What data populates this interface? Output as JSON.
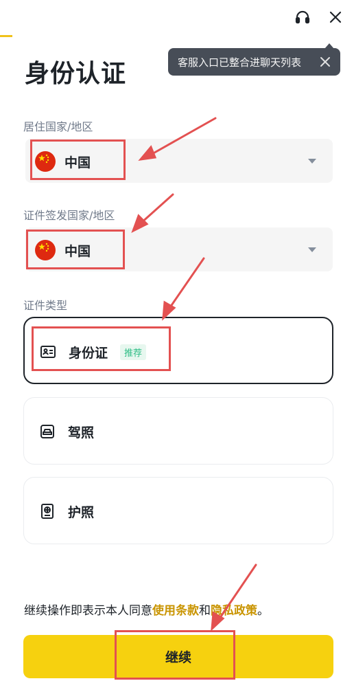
{
  "toast": {
    "text": "客服入口已整合进聊天列表"
  },
  "page": {
    "title": "身份认证"
  },
  "residence": {
    "label": "居住国家/地区",
    "value": "中国"
  },
  "issuing": {
    "label": "证件签发国家/地区",
    "value": "中国"
  },
  "doc_type": {
    "label": "证件类型",
    "options": [
      {
        "label": "身份证",
        "badge": "推荐",
        "icon": "id-card-icon",
        "selected": true
      },
      {
        "label": "驾照",
        "icon": "driver-license-icon",
        "selected": false
      },
      {
        "label": "护照",
        "icon": "passport-icon",
        "selected": false
      }
    ]
  },
  "terms": {
    "prefix": "继续操作即表示本人同意",
    "link1": "使用条款",
    "and": "和",
    "link2": "隐私政策",
    "suffix": "。"
  },
  "continue_button": {
    "label": "继续"
  },
  "colors": {
    "accent": "#f6d10f",
    "link": "#c99400",
    "badge": "#2ebd85",
    "annotation": "#e35151"
  }
}
